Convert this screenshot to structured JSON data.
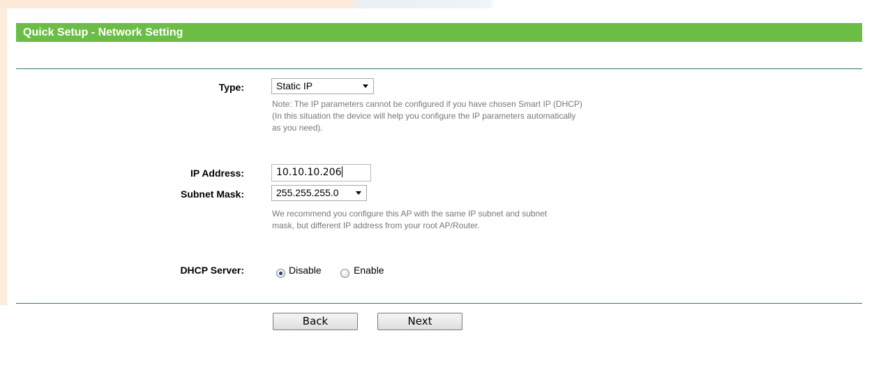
{
  "header": {
    "title": "Quick Setup - Network Setting"
  },
  "form": {
    "type": {
      "label": "Type:",
      "value": "Static IP",
      "note_lines": [
        "Note: The IP parameters cannot be configured if you have chosen Smart IP (DHCP)",
        "(In this situation the device will help you configure the IP parameters automatically",
        "as you need)."
      ]
    },
    "ip_address": {
      "label": "IP Address:",
      "value": "10.10.10.206"
    },
    "subnet_mask": {
      "label": "Subnet Mask:",
      "value": "255.255.255.0",
      "note_lines": [
        "We recommend you configure this AP with the same IP subnet and subnet",
        "mask, but different IP address from your root AP/Router."
      ]
    },
    "dhcp_server": {
      "label": "DHCP Server:",
      "options": [
        "Disable",
        "Enable"
      ],
      "selected": "Disable"
    }
  },
  "buttons": {
    "back": "Back",
    "next": "Next"
  },
  "colors": {
    "header": "#6cbd45",
    "rule": "#2e7d4f"
  }
}
